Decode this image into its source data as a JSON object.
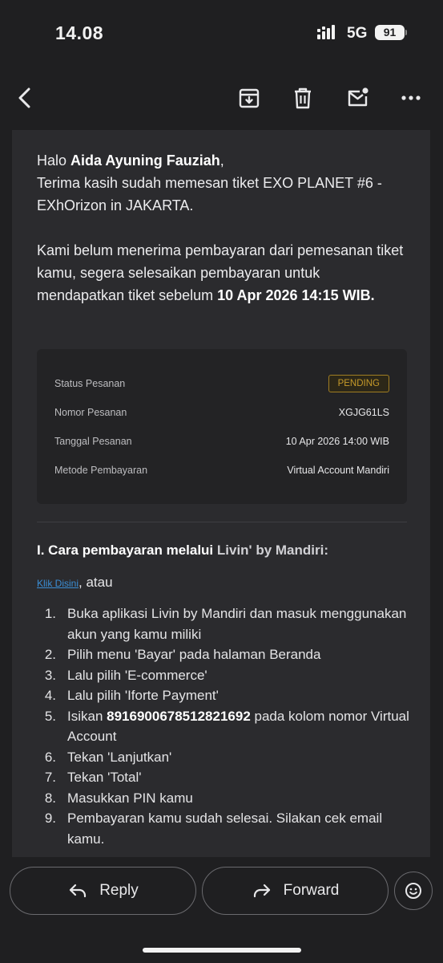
{
  "status_bar": {
    "time": "14.08",
    "network": "5G",
    "battery": "91"
  },
  "toolbar": {
    "icons": [
      "back-icon",
      "archive-icon",
      "trash-icon",
      "mark-unread-icon",
      "more-icon"
    ]
  },
  "email": {
    "greeting_prefix": "Halo ",
    "recipient_name": "Aida Ayuning Fauziah",
    "greeting_suffix": ",",
    "thanks_line": "Terima kasih sudah memesan tiket EXO PLANET #6 - EXhOrizon in JAKARTA.",
    "payment_notice": "Kami belum menerima pembayaran dari pemesanan tiket kamu, segera selesaikan pembayaran untuk mendapatkan tiket sebelum ",
    "deadline": "10 Apr 2026 14:15 WIB.",
    "order_summary": {
      "status_label": "Status Pesanan",
      "status_value": "PENDING",
      "order_number_label": "Nomor Pesanan",
      "order_number_value": "XGJG61LS",
      "order_date_label": "Tanggal Pesanan",
      "order_date_value": "10 Apr 2026 14:00 WIB",
      "payment_method_label": "Metode Pembayaran",
      "payment_method_value": "Virtual Account Mandiri"
    },
    "section_title_prefix": "I. Cara pembayaran melalui ",
    "section_title_brand": "Livin' by Mandiri:",
    "link_text": "Klik Disini",
    "link_suffix": ", atau",
    "steps": [
      {
        "num": "1.",
        "text": "Buka aplikasi Livin by Mandiri dan masuk menggunakan akun yang kamu miliki"
      },
      {
        "num": "2.",
        "text": "Pilih menu 'Bayar' pada halaman Beranda"
      },
      {
        "num": "3.",
        "text": "Lalu pilih 'E-commerce'"
      },
      {
        "num": "4.",
        "text": "Lalu pilih 'Iforte Payment'"
      },
      {
        "num": "5.",
        "pre": "Isikan ",
        "bold": "8916900678512821692",
        "post": " pada kolom nomor Virtual Account"
      },
      {
        "num": "6.",
        "text": "Tekan 'Lanjutkan'"
      },
      {
        "num": "7.",
        "text": "Tekan 'Total'"
      },
      {
        "num": "8.",
        "text": "Masukkan PIN kamu"
      },
      {
        "num": "9.",
        "text": "Pembayaran kamu sudah selesai. Silakan cek email kamu."
      }
    ]
  },
  "actions": {
    "reply_label": "Reply",
    "forward_label": "Forward"
  },
  "colors": {
    "background": "#1f1f21",
    "card": "#2b2b2e",
    "pending": "#c69a2a",
    "link": "#3b8fd6"
  }
}
